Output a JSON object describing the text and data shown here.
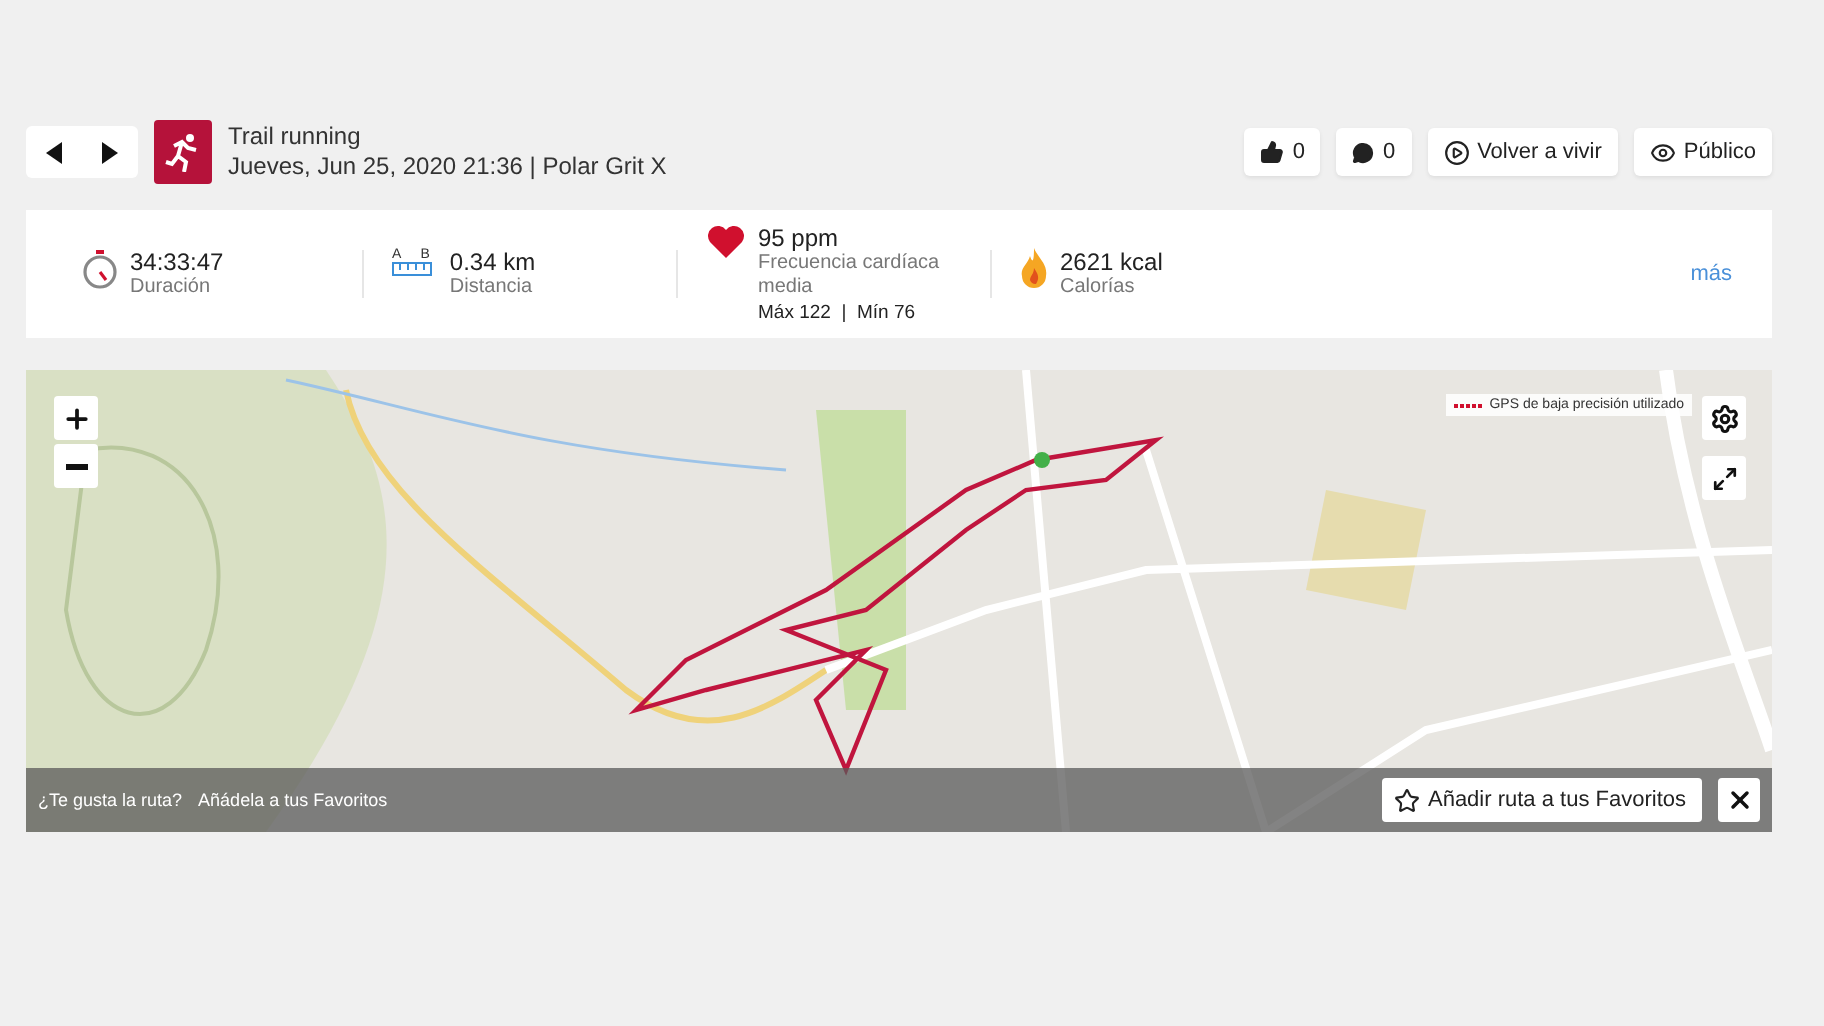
{
  "activity": {
    "title": "Trail running",
    "details": "Jueves, Jun 25, 2020 21:36 | Polar Grit X"
  },
  "actions": [
    {
      "kind": "like",
      "label": "0"
    },
    {
      "kind": "comment",
      "label": "0"
    },
    {
      "kind": "replay",
      "label": "Volver a vivir"
    },
    {
      "kind": "visibility",
      "label": "Público"
    }
  ],
  "stats": [
    {
      "kind": "duration",
      "value": "34:33:47",
      "label": "Duración"
    },
    {
      "kind": "distance",
      "value": "0.34 km",
      "label": "Distancia",
      "endpoints": [
        "A",
        "B"
      ]
    },
    {
      "kind": "heart_rate",
      "value": "95 ppm",
      "label": "Frecuencia cardíaca media",
      "range": "Máx 122  |  Mín 76"
    },
    {
      "kind": "calories",
      "value": "2621 kcal",
      "label": "Calorías"
    }
  ],
  "more": "más",
  "map": {
    "legend": "GPS de baja precisión utilizado",
    "banner": {
      "question": "¿Te gusta la ruta?",
      "hint": "Añádela a tus Favoritos",
      "button": "Añadir ruta a tus Favoritos"
    }
  }
}
